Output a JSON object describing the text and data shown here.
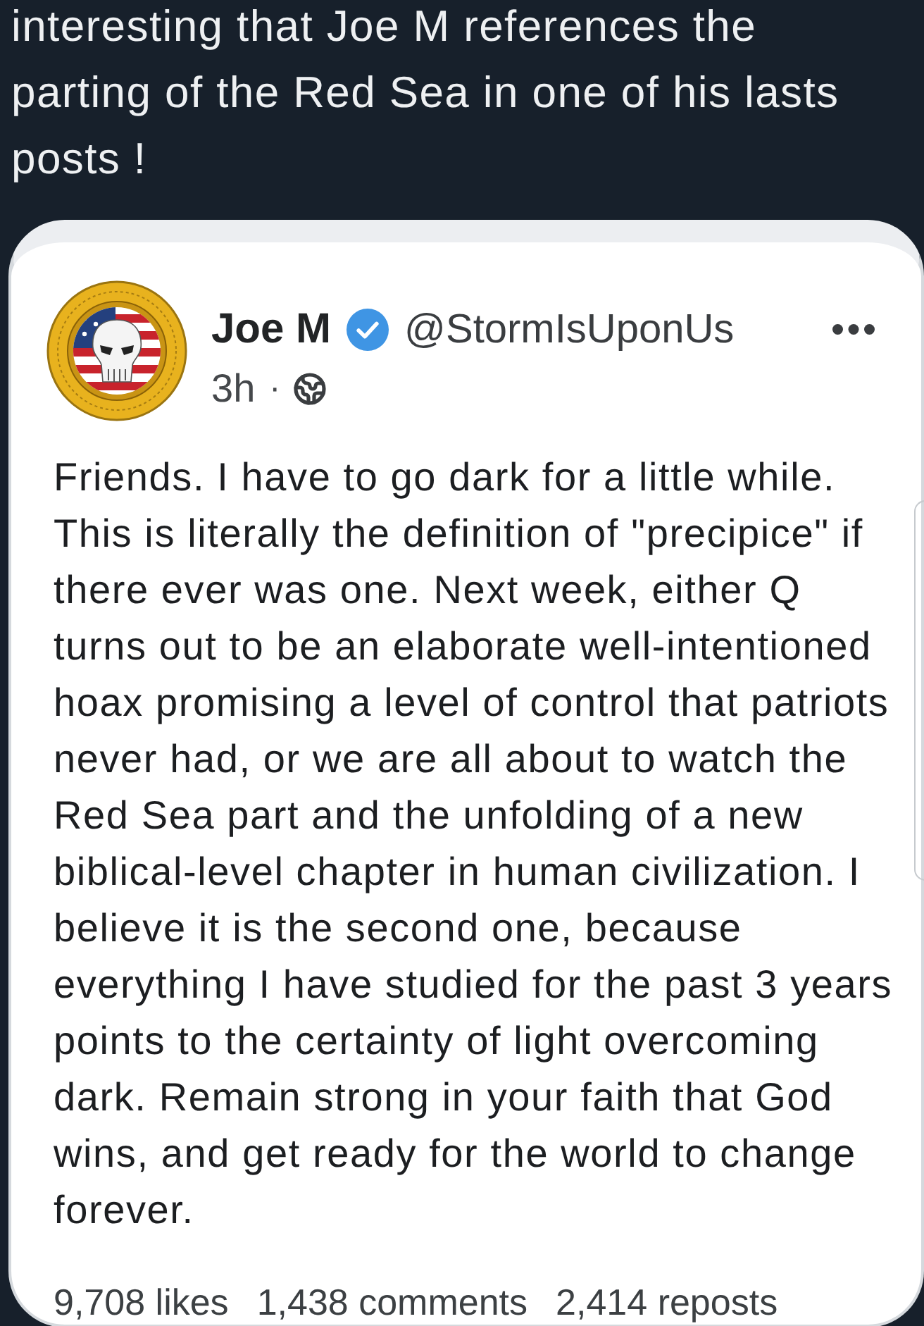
{
  "caption": "interesting that Joe M references the parting of the Red Sea in one of his lasts posts !",
  "post": {
    "author": {
      "name": "Joe M",
      "verified": true,
      "handle": "@StormIsUponUs"
    },
    "time": "3h",
    "separator": "·",
    "text": "Friends. I have to go dark for a little while. This is literally the definition of \"precipice\" if there ever was one. Next week, either Q turns out to be an elaborate well-intentioned hoax promising a level of control that patriots never had, or we are all about to watch the Red Sea part and the unfolding of a new biblical-level chapter in human civilization. I believe it is the second one, because everything I have studied for the past 3 years points to the certainty of light overcoming dark. Remain strong in your faith that God wins, and get ready for the world to change forever.",
    "stats": [
      "9,708 likes",
      "1,438 comments",
      "2,414 reposts"
    ]
  }
}
